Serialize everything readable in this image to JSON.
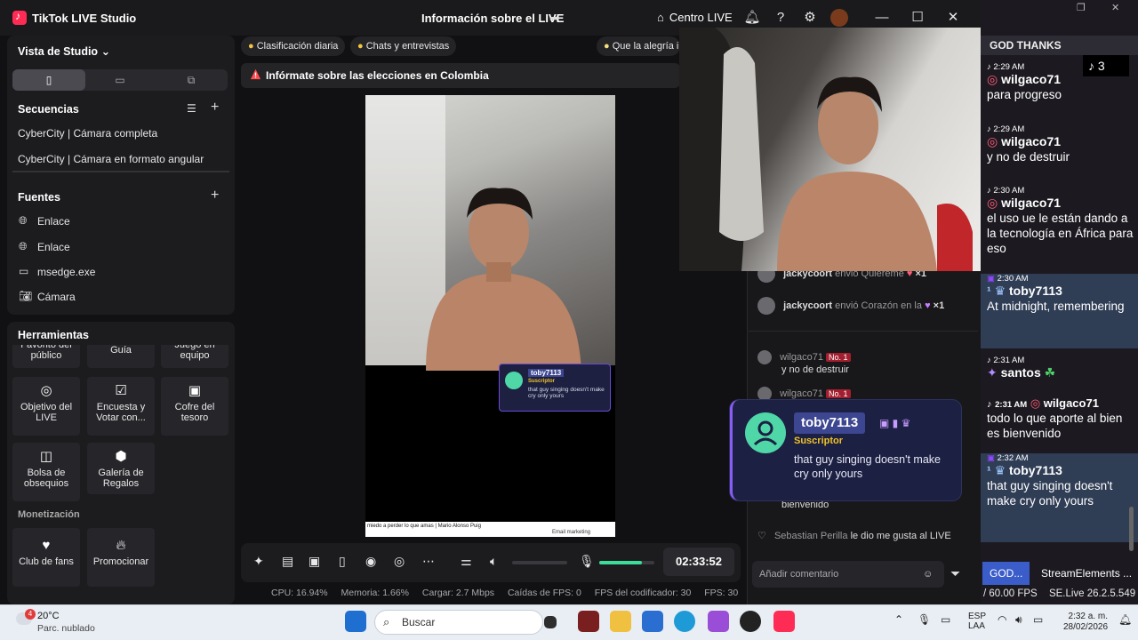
{
  "window": {
    "app_title": "TikTok LIVE Studio",
    "center_title": "Información sobre el LIVE",
    "live_center": "Centro LIVE"
  },
  "studio": {
    "view_label": "Vista de Studio",
    "sequences_label": "Secuencias",
    "sequences": [
      "CyberCity | Cámara completa",
      "CyberCity | Cámara en formato angular"
    ],
    "sources_label": "Fuentes",
    "sources": [
      {
        "icon": "globe-icon",
        "label": "Enlace"
      },
      {
        "icon": "globe-icon",
        "label": "Enlace"
      },
      {
        "icon": "window-icon",
        "label": "msedge.exe"
      },
      {
        "icon": "camera-icon",
        "label": "Cámara"
      }
    ],
    "tools_label": "Herramientas",
    "tools_top_partial": [
      "Favorito del público",
      "Guía",
      "Juego en equipo"
    ],
    "tools": [
      {
        "icon": "target-icon",
        "label": "Objetivo del LIVE"
      },
      {
        "icon": "poll-icon",
        "label": "Encuesta y Votar con..."
      },
      {
        "icon": "chest-icon",
        "label": "Cofre del tesoro"
      },
      {
        "icon": "bag-icon",
        "label": "Bolsa de obsequios"
      },
      {
        "icon": "gallery-icon",
        "label": "Galería de Regalos"
      }
    ],
    "monetization_label": "Monetización",
    "monetization": [
      {
        "icon": "fanclub-icon",
        "label": "Club de fans"
      },
      {
        "icon": "promote-icon",
        "label": "Promocionar"
      }
    ]
  },
  "chips": [
    "Clasificación diaria",
    "Chats y entrevistas",
    "Que la alegría i"
  ],
  "alert": "Infórmate sobre las elecciones en Colombia",
  "preview": {
    "overlay_name": "toby7113",
    "overlay_sub": "Suscriptor",
    "overlay_msg": "that guy singing doesn't make cry only yours",
    "strip_text": "miedo a perder lo que amas | Mario Alonso Puig",
    "strip_btn": "Email marketing"
  },
  "controls": {
    "timer": "02:33:52",
    "mic_level": 0.78
  },
  "stats": {
    "cpu": "CPU: 16.94%",
    "memory": "Memoria: 1.66%",
    "upload": "Cargar: 2.7 Mbps",
    "frame_drops": "Caídas de FPS: 0",
    "encoder_fps": "FPS del codificador: 30",
    "fps": "FPS: 30"
  },
  "live_chat": {
    "gift1": {
      "user": "jackycoort",
      "text": "envió Quiéreme",
      "count": "×1"
    },
    "gift2": {
      "user": "jackycoort",
      "text": "envió Corazón en la",
      "count": "×1"
    },
    "msg1_user": "wilgaco71",
    "msg1_badge": "No. 1",
    "msg1_text": "y no de destruir",
    "msg2_user": "wilgaco71",
    "msg2_badge": "No. 1",
    "msg3_tail": "bienvenido",
    "msg4": {
      "user": "Sebastian Perilla",
      "text": "le dio me gusta al LIVE"
    },
    "comment_placeholder": "Añadir comentario"
  },
  "overlay_card": {
    "name": "toby7113",
    "role": "Suscriptor",
    "message": "that guy singing doesn't make cry only yours"
  },
  "stream_chat": {
    "header": "GOD THANKS",
    "viewer_count": "3",
    "messages": [
      {
        "time": "2:29 AM",
        "user": "wilgaco71",
        "text": "para progreso",
        "platform": "tiktok"
      },
      {
        "time": "2:29 AM",
        "user": "wilgaco71",
        "text": "y no de destruir",
        "platform": "tiktok"
      },
      {
        "time": "2:30 AM",
        "user": "wilgaco71",
        "text": "el uso ue le están dando a la tecnología en África para eso",
        "platform": "tiktok"
      },
      {
        "time": "2:30 AM",
        "user": "toby7113",
        "text": "At midnight, remembering",
        "platform": "twitch"
      },
      {
        "time": "2:31 AM",
        "user": "santos",
        "text": "",
        "platform": "tiktok"
      },
      {
        "time": "2:31 AM",
        "user": "wilgaco71",
        "text": "todo lo que aporte al bien es bienvenido",
        "platform": "tiktok"
      },
      {
        "time": "2:32 AM",
        "user": "toby7113",
        "text": "that guy singing doesn't make cry only yours",
        "platform": "twitch"
      }
    ],
    "tabs": [
      "GOD...",
      "StreamElements ..."
    ],
    "fps": "/ 60.00 FPS",
    "version": "SE.Live 26.2.5.549"
  },
  "taskbar": {
    "weather_temp": "20°C",
    "weather_desc": "Parc. nublado",
    "weather_badge": "4",
    "search_placeholder": "Buscar",
    "lang1": "ESP",
    "lang2": "LAA",
    "time": "2:32 a. m.",
    "date": "28/02/2026"
  },
  "colors": {
    "accent_tiktok": "#fe2c55",
    "twitch": "#9146ff",
    "mic_green": "#3ddc97",
    "panel_bg": "#1c1c1f"
  }
}
